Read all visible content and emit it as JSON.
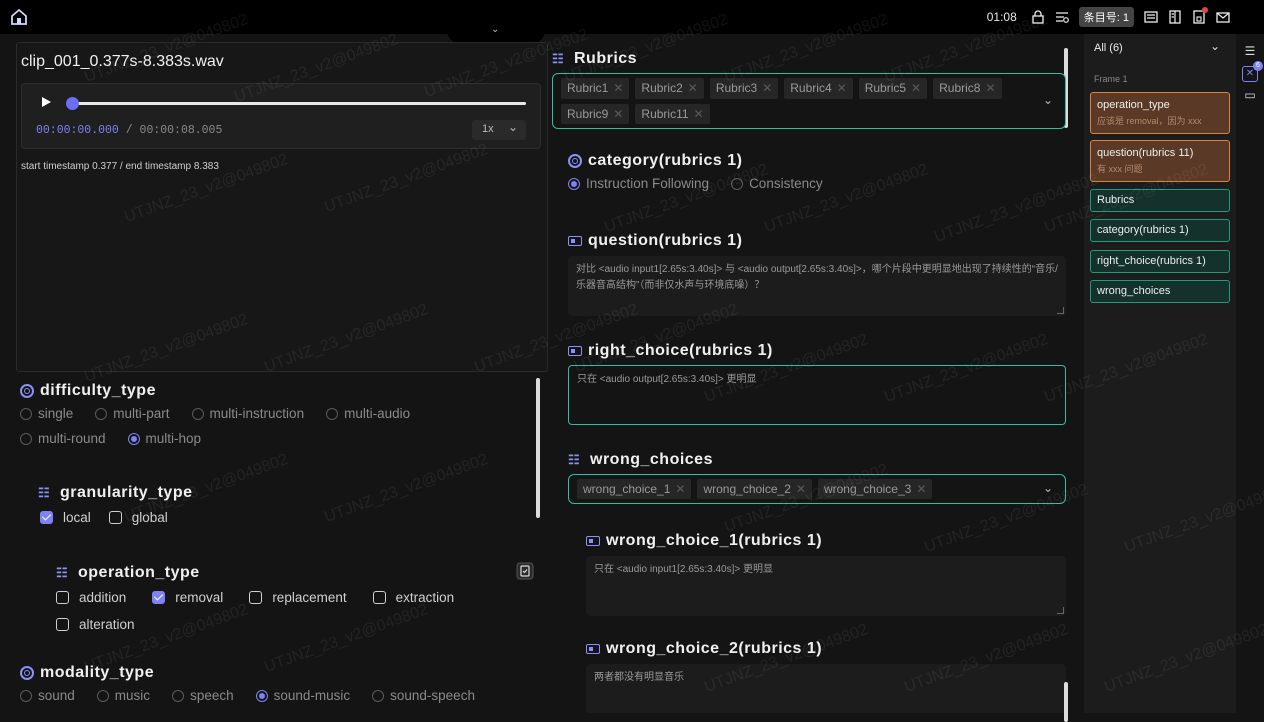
{
  "topbar": {
    "time": "01:08",
    "item_label": "条目号: 1",
    "notch_chevron": "⌄",
    "icons": [
      "home-icon",
      "lock-icon",
      "list-icon",
      "list-detail-icon",
      "sidebar-icon",
      "document-icon",
      "mail-icon"
    ]
  },
  "player": {
    "clip_title": "clip_001_0.377s-8.383s.wav",
    "current_time": "00:00:00.000",
    "separator": " / ",
    "total_time": "00:00:08.005",
    "speed": "1x",
    "progress_fraction": 0.0,
    "timestamps": "start timestamp 0.377 / end timestamp 8.383"
  },
  "difficulty": {
    "title": "difficulty_type",
    "options": [
      "single",
      "multi-part",
      "multi-instruction",
      "multi-audio",
      "multi-round",
      "multi-hop"
    ],
    "selected": "multi-hop"
  },
  "granularity": {
    "title": "granularity_type",
    "options": [
      {
        "label": "local",
        "checked": true
      },
      {
        "label": "global",
        "checked": false
      }
    ]
  },
  "operation": {
    "title": "operation_type",
    "options": [
      {
        "label": "addition",
        "checked": false
      },
      {
        "label": "removal",
        "checked": true
      },
      {
        "label": "replacement",
        "checked": false
      },
      {
        "label": "extraction",
        "checked": false
      },
      {
        "label": "alteration",
        "checked": false
      }
    ]
  },
  "modality": {
    "title": "modality_type",
    "options": [
      "sound",
      "music",
      "speech",
      "sound-music",
      "sound-speech"
    ],
    "selected": "sound-music"
  },
  "rubrics": {
    "title": "Rubrics",
    "tags": [
      "Rubric1",
      "Rubric2",
      "Rubric3",
      "Rubric4",
      "Rubric5",
      "Rubric8",
      "Rubric9",
      "Rubric11"
    ]
  },
  "category": {
    "title": "category(rubrics 1)",
    "options": [
      "Instruction Following",
      "Consistency"
    ],
    "selected": "Instruction Following"
  },
  "question": {
    "title": "question(rubrics 1)",
    "text": "对比 <audio input1[2.65s:3.40s]> 与 <audio output[2.65s:3.40s]>，哪个片段中更明显地出现了持续性的“音乐/乐器音高结构”（而非仅水声与环境底噪）？"
  },
  "right_choice": {
    "title": "right_choice(rubrics 1)",
    "text": "只在 <audio output[2.65s:3.40s]> 更明显"
  },
  "wrong_choices": {
    "title": "wrong_choices",
    "tags": [
      "wrong_choice_1",
      "wrong_choice_2",
      "wrong_choice_3"
    ]
  },
  "wrong_choice_1": {
    "title": "wrong_choice_1(rubrics 1)",
    "text": "只在 <audio input1[2.65s:3.40s]> 更明显"
  },
  "wrong_choice_2": {
    "title": "wrong_choice_2(rubrics 1)",
    "text": "两者都没有明显音乐"
  },
  "side_panel": {
    "filter": "All (6)",
    "frame_label": "Frame 1",
    "cards": [
      {
        "title": "operation_type",
        "sub": "应该是 removal，因为 xxx",
        "style": "orange"
      },
      {
        "title": "question(rubrics 11)",
        "sub": "有 xxx 问题",
        "style": "orange"
      },
      {
        "title": "Rubrics",
        "style": "green"
      },
      {
        "title": "category(rubrics 1)",
        "style": "green"
      },
      {
        "title": "right_choice(rubrics 1)",
        "style": "green"
      },
      {
        "title": "wrong_choices",
        "style": "green"
      }
    ]
  },
  "rail": {
    "badge": "6"
  },
  "watermark": "UTJNZ_23_v2@049802",
  "colors": {
    "accent": "#7d83f5",
    "teal": "#33bca5",
    "orange": "#d3853f",
    "green": "#1f9c7e"
  }
}
